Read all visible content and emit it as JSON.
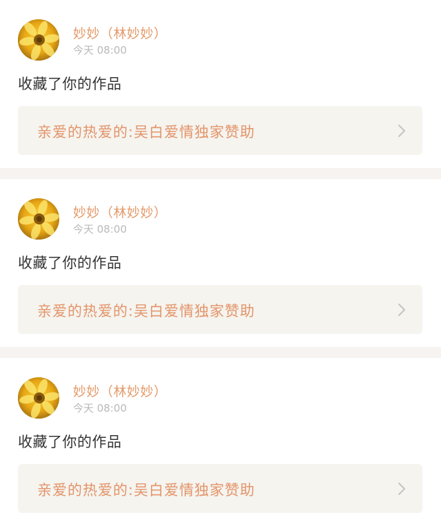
{
  "notifications": [
    {
      "avatar_icon": "sunflower-avatar-icon",
      "user_name": "妙妙（林妙妙）",
      "timestamp": "今天 08:00",
      "action": "收藏了你的作品",
      "work_title": "亲爱的热爱的:吴白爱情独家赞助",
      "chevron_icon": "chevron-right-icon"
    },
    {
      "avatar_icon": "sunflower-avatar-icon",
      "user_name": "妙妙（林妙妙）",
      "timestamp": "今天 08:00",
      "action": "收藏了你的作品",
      "work_title": "亲爱的热爱的:吴白爱情独家赞助",
      "chevron_icon": "chevron-right-icon"
    },
    {
      "avatar_icon": "sunflower-avatar-icon",
      "user_name": "妙妙（林妙妙）",
      "timestamp": "今天 08:00",
      "action": "收藏了你的作品",
      "work_title": "亲爱的热爱的:吴白爱情独家赞助",
      "chevron_icon": "chevron-right-icon"
    }
  ],
  "colors": {
    "user_name": "#e39a6a",
    "timestamp": "#b9b9b9",
    "action_text": "#333333",
    "work_title": "#e3946a",
    "work_link_bg": "#f5f4ef",
    "separator": "#f6f3f0"
  }
}
